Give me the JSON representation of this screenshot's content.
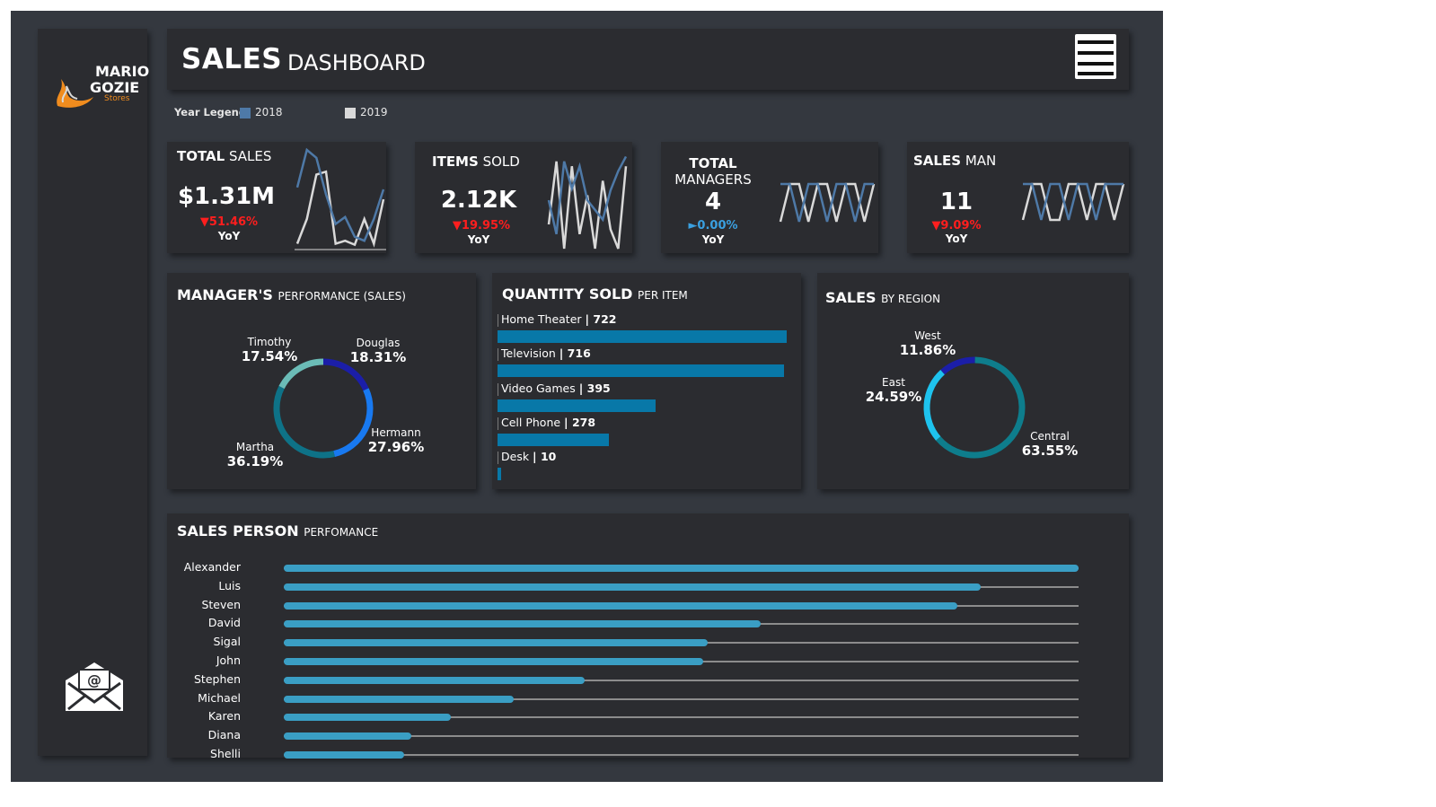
{
  "brand": {
    "line1": "MARIO",
    "line2": "GOZIE",
    "sub": "Stores"
  },
  "header": {
    "title_bold": "SALES",
    "title_rest": "DASHBOARD"
  },
  "legend": {
    "label": "Year Legend",
    "y2018": "2018",
    "y2019": "2019",
    "c2018": "#4e79a7",
    "c2019": "#d9d9d9"
  },
  "kpis": {
    "sales": {
      "bold": "TOTAL",
      "rest": "SALES",
      "value": "$1.31M",
      "change": "▼51.46%",
      "yoy": "YoY",
      "change_color": "#ff1e1e",
      "s2018": [
        0.62,
        1.0,
        0.92,
        0.55,
        0.25,
        0.32,
        0.12,
        0.08,
        0.3,
        0.6
      ],
      "s2019": [
        0.05,
        0.3,
        0.75,
        0.78,
        0.05,
        0.08,
        0.04,
        0.3,
        0.05,
        0.5
      ]
    },
    "items": {
      "bold": "ITEMS",
      "rest": "SOLD",
      "value": "2.12K",
      "change": "▼19.95%",
      "yoy": "YoY",
      "change_color": "#ff1e1e",
      "s2018": [
        0.5,
        0.15,
        0.9,
        0.62,
        0.85,
        0.5,
        0.4,
        0.3,
        0.6,
        0.8,
        0.95
      ],
      "s2019": [
        0.25,
        0.9,
        0.0,
        0.85,
        0.15,
        0.55,
        0.0,
        0.7,
        0.2,
        0.0,
        0.85
      ]
    },
    "managers": {
      "bold": "TOTAL",
      "rest": "MANAGERS",
      "value": "4",
      "change": "►0.00%",
      "yoy": "YoY",
      "change_color": "#3aa0e0",
      "s2018": [
        1,
        1,
        0,
        1,
        1,
        0,
        1,
        1,
        0,
        1,
        1
      ],
      "s2019": [
        0,
        1,
        1,
        0,
        1,
        1,
        0,
        1,
        1,
        0,
        1
      ]
    },
    "salesman": {
      "bold": "SALES",
      "rest": "MAN",
      "value": "11",
      "change": "▼9.09%",
      "yoy": "YoY",
      "change_color": "#ff1e1e",
      "s2018": [
        1,
        1,
        0,
        1,
        1,
        0,
        1,
        1,
        0,
        1,
        1,
        1
      ],
      "s2019": [
        0,
        1,
        1,
        0,
        0,
        1,
        1,
        0,
        1,
        1,
        0,
        1
      ]
    }
  },
  "manager_perf": {
    "bold": "MANAGER'S",
    "rest": "PERFORMANCE (SALES)"
  },
  "quantity": {
    "bold": "QUANTITY SOLD",
    "rest": "PER ITEM"
  },
  "region": {
    "bold": "SALES",
    "rest": "BY REGION"
  },
  "salesperson": {
    "bold": "SALES PERSON",
    "rest": "PERFOMANCE"
  },
  "chart_data": [
    {
      "type": "pie",
      "title": "MANAGER'S PERFORMANCE (SALES)",
      "slices": [
        {
          "label": "Douglas",
          "value": 18.31,
          "display": "18.31%",
          "color": "#1b1ea8"
        },
        {
          "label": "Hermann",
          "value": 27.96,
          "display": "27.96%",
          "color": "#1879f0"
        },
        {
          "label": "Martha",
          "value": 36.19,
          "display": "36.19%",
          "color": "#0e7287"
        },
        {
          "label": "Timothy",
          "value": 17.54,
          "display": "17.54%",
          "color": "#6bbcb7"
        }
      ]
    },
    {
      "type": "bar",
      "title": "QUANTITY SOLD PER ITEM",
      "categories": [
        "Home Theater",
        "Television",
        "Video Games",
        "Cell Phone",
        "Desk"
      ],
      "values": [
        722,
        716,
        395,
        278,
        10
      ],
      "color": "#0878a8"
    },
    {
      "type": "pie",
      "title": "SALES BY REGION",
      "slices": [
        {
          "label": "West",
          "value": 11.86,
          "display": "11.86%",
          "color": "#1b1ea8"
        },
        {
          "label": "Central",
          "value": 63.55,
          "display": "63.55%",
          "color": "#0e7d8c"
        },
        {
          "label": "East",
          "value": 24.59,
          "display": "24.59%",
          "color": "#1ec3ee"
        }
      ]
    },
    {
      "type": "bar",
      "title": "SALES PERSON PERFOMANCE",
      "categories": [
        "Alexander",
        "Luis",
        "Steven",
        "David",
        "Sigal",
        "John",
        "Stephen",
        "Michael",
        "Karen",
        "Diana",
        "Shelli"
      ],
      "values": [
        1.0,
        0.877,
        0.848,
        0.6,
        0.533,
        0.528,
        0.378,
        0.289,
        0.21,
        0.161,
        0.151
      ],
      "color": "#3a9ec4",
      "track_color": "#8c8c8c"
    }
  ]
}
